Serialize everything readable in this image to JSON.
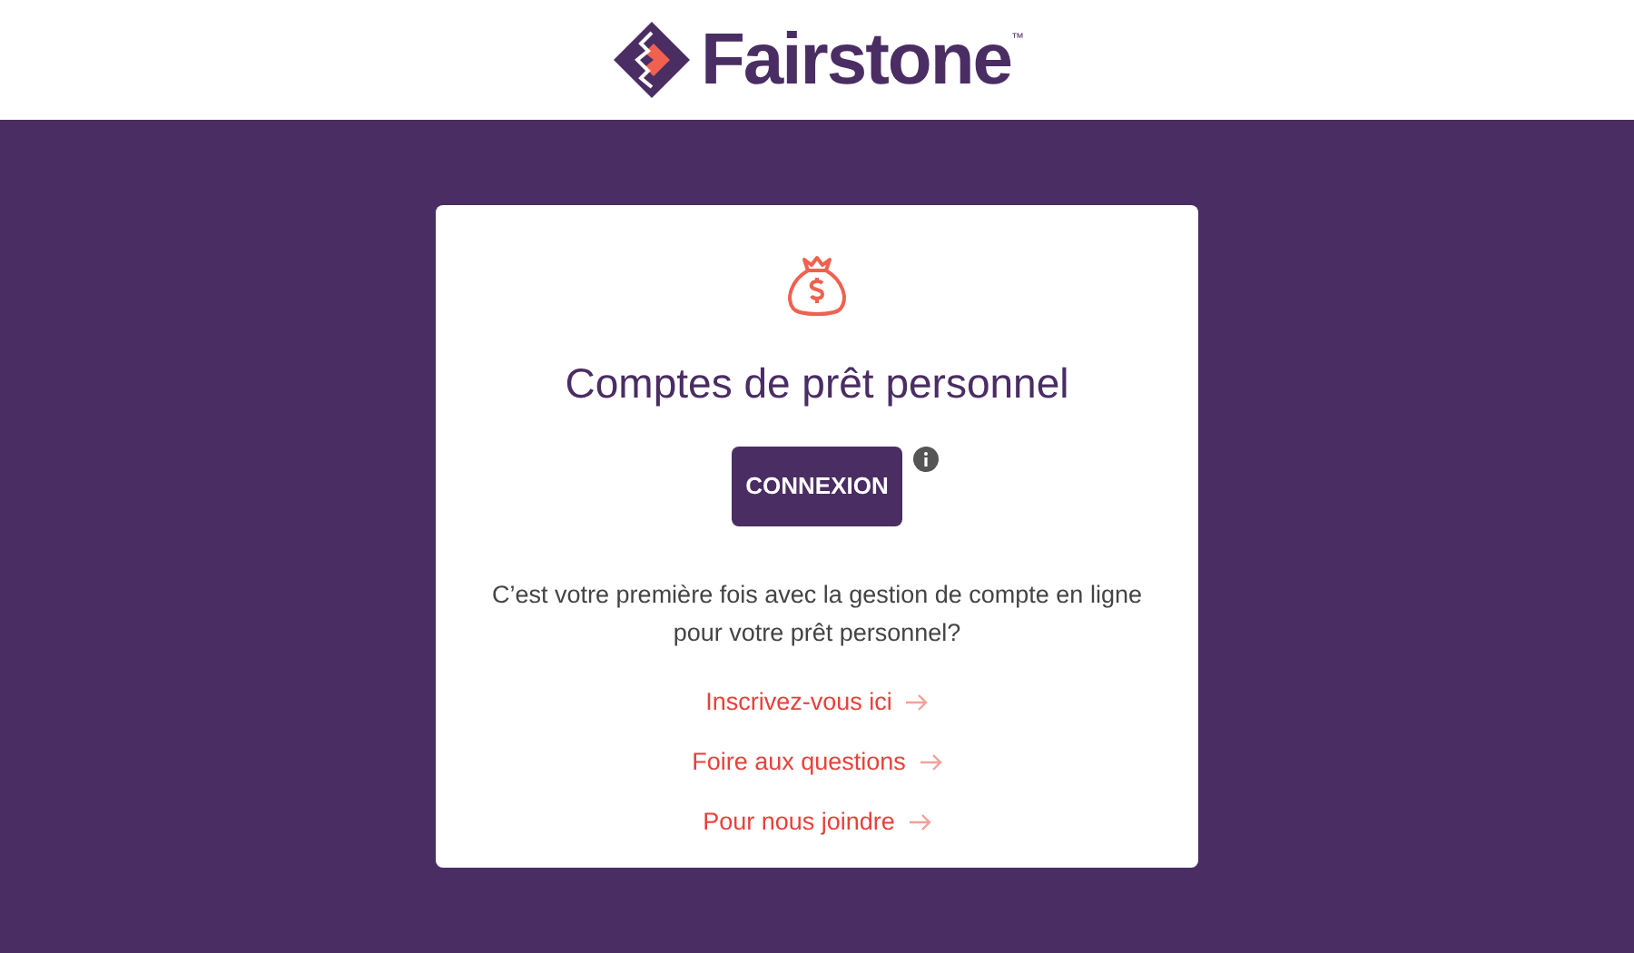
{
  "header": {
    "logo": {
      "name": "Fairstone",
      "trademark": "™"
    }
  },
  "card": {
    "title": "Comptes de prêt personnel",
    "login_button": "CONNEXION",
    "question": "C’est votre première fois avec la gestion de compte en ligne pour votre prêt personnel?",
    "links": [
      {
        "label": "Inscrivez-vous ici"
      },
      {
        "label": "Foire aux questions"
      },
      {
        "label": "Pour nous joindre"
      }
    ]
  }
}
